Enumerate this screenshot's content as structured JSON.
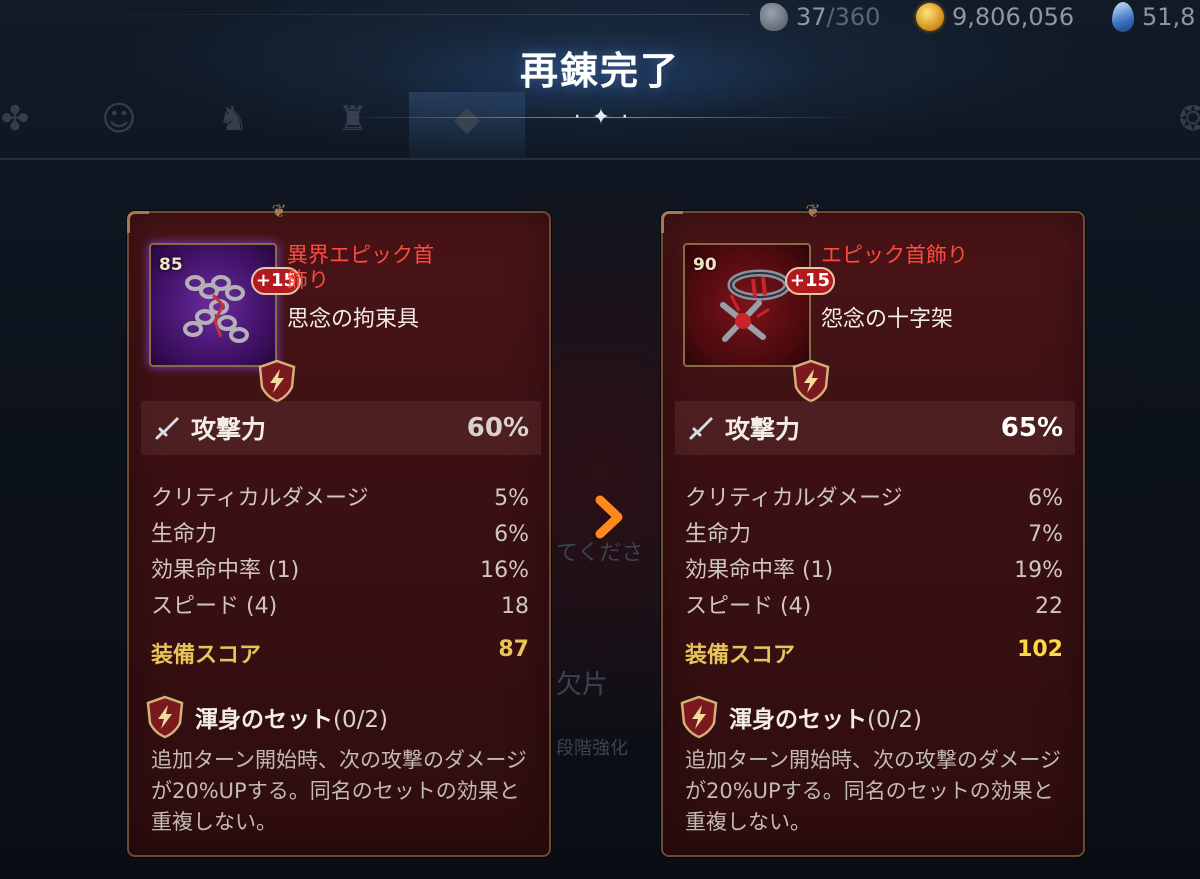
{
  "title": "再錬完了",
  "currencies": {
    "stamina": {
      "value": "37",
      "max": "/360"
    },
    "gold": {
      "value": "9,806,056"
    },
    "crystal": {
      "value": "51,8"
    }
  },
  "background_text": {
    "hint": "てくださ",
    "shard": "欠片",
    "enhance": "段階強化"
  },
  "before": {
    "level": "85",
    "enhance": "+15",
    "rarity": "異界エピック首飾り",
    "name": "思念の拘束具",
    "main_stat": {
      "label": "攻撃力",
      "value": "60%"
    },
    "substats": [
      {
        "label": "クリティカルダメージ",
        "value": "5%"
      },
      {
        "label": "生命力",
        "value": "6%"
      },
      {
        "label": "効果命中率 (1)",
        "value": "16%"
      },
      {
        "label": "スピード (4)",
        "value": "18"
      }
    ],
    "score": {
      "label": "装備スコア",
      "value": "87"
    },
    "set": {
      "name": "渾身のセット",
      "count": "(0/2)",
      "description": "追加ターン開始時、次の攻撃のダメージが20%UPする。同名のセットの効果と重複しない。"
    }
  },
  "after": {
    "level": "90",
    "enhance": "+15",
    "rarity": "エピック首飾り",
    "name": "怨念の十字架",
    "main_stat": {
      "label": "攻撃力",
      "value": "65%"
    },
    "substats": [
      {
        "label": "クリティカルダメージ",
        "value": "6%"
      },
      {
        "label": "生命力",
        "value": "7%"
      },
      {
        "label": "効果命中率 (1)",
        "value": "19%"
      },
      {
        "label": "スピード (4)",
        "value": "22"
      }
    ],
    "score": {
      "label": "装備スコア",
      "value": "102"
    },
    "set": {
      "name": "渾身のセット",
      "count": "(0/2)",
      "description": "追加ターン開始時、次の攻撃のダメージが20%UPする。同名のセットの効果と重複しない。"
    }
  },
  "icons": {
    "arrow": "chevron-right-icon",
    "set": "lightning-shield-icon",
    "main_stat": "sword-icon"
  },
  "colors": {
    "rarity": "#ff4a3f",
    "score": "#e7c45c",
    "arrow": "#ff8a1c",
    "card_border": "#6f4a35"
  }
}
